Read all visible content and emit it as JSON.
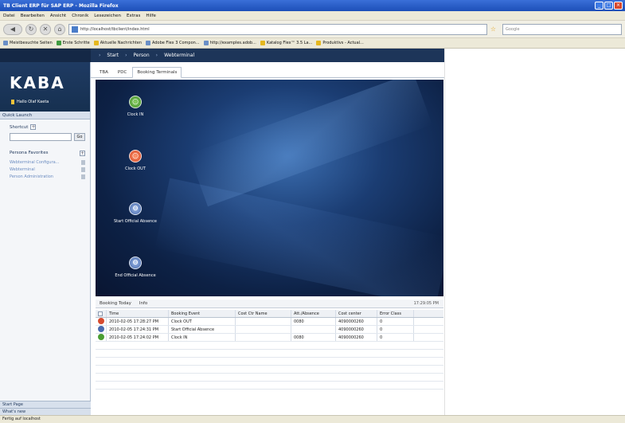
{
  "window": {
    "title": "TB Client ERP für SAP ERP - Mozilla Firefox"
  },
  "menu": [
    "Datei",
    "Bearbeiten",
    "Ansicht",
    "Chronik",
    "Lesezeichen",
    "Extras",
    "Hilfe"
  ],
  "nav": {
    "url": "http://localhost/tbclient/index.html",
    "search_placeholder": "Google"
  },
  "bookmarks": [
    {
      "label": "Meistbesuchte Seiten",
      "color": "#6a8fc7"
    },
    {
      "label": "Erste Schritte",
      "color": "#3f9a3f"
    },
    {
      "label": "Aktuelle Nachrichten",
      "color": "#e5b71e"
    },
    {
      "label": "Adobe Flex 3 Compon...",
      "color": "#6a8fc7"
    },
    {
      "label": "http://examples.adob...",
      "color": "#6a8fc7"
    },
    {
      "label": "Katalog Flex™ 3.5 La...",
      "color": "#e5b71e"
    },
    {
      "label": "Produktivs - Actual...",
      "color": "#e5b71e"
    }
  ],
  "app": {
    "topnav": [
      "Start",
      "Person",
      "Webterminal"
    ],
    "logo": "KABA",
    "user": "Hallo Olaf Kaeta",
    "quick_launch": "Quick Launch",
    "shortcut_label": "Shortcut",
    "go_label": "Go",
    "favorites_title": "Persona Favorites",
    "favorites": [
      "Webterminal Configura...",
      "Webterminal",
      "Person Administration"
    ],
    "bottom_links": [
      "Start Page",
      "What's new"
    ]
  },
  "content": {
    "tabs": [
      "TBA",
      "PDC",
      "Booking Terminals"
    ],
    "actions": [
      {
        "label": "Clock IN",
        "color": "green"
      },
      {
        "label": "Clock OUT",
        "color": "red"
      },
      {
        "label": "Start Official Absence",
        "color": "blue"
      },
      {
        "label": "End Official Absence",
        "color": "blue"
      }
    ],
    "bottom_tabs": [
      "Booking Today",
      "Info"
    ],
    "time": "17:29:05 PM",
    "grid": {
      "columns": [
        "",
        "Time",
        "Booking Event",
        "Cost Ctr Name",
        "Att./Absence",
        "Cost center",
        "Error Class"
      ],
      "rows": [
        {
          "status": "red",
          "time": "2010-02-05 17:28:27 PM",
          "event": "Clock OUT",
          "cost_ctr": "",
          "att": "0080",
          "cost_center": "4090000260",
          "error": "0"
        },
        {
          "status": "blue",
          "time": "2010-02-05 17:24:31 PM",
          "event": "Start Official Absence",
          "cost_ctr": "",
          "att": "",
          "cost_center": "4090000260",
          "error": "0"
        },
        {
          "status": "green",
          "time": "2010-02-05 17:24:02 PM",
          "event": "Clock IN",
          "cost_ctr": "",
          "att": "0080",
          "cost_center": "4090000260",
          "error": "0"
        }
      ]
    }
  },
  "status": "Fertig auf localhost"
}
